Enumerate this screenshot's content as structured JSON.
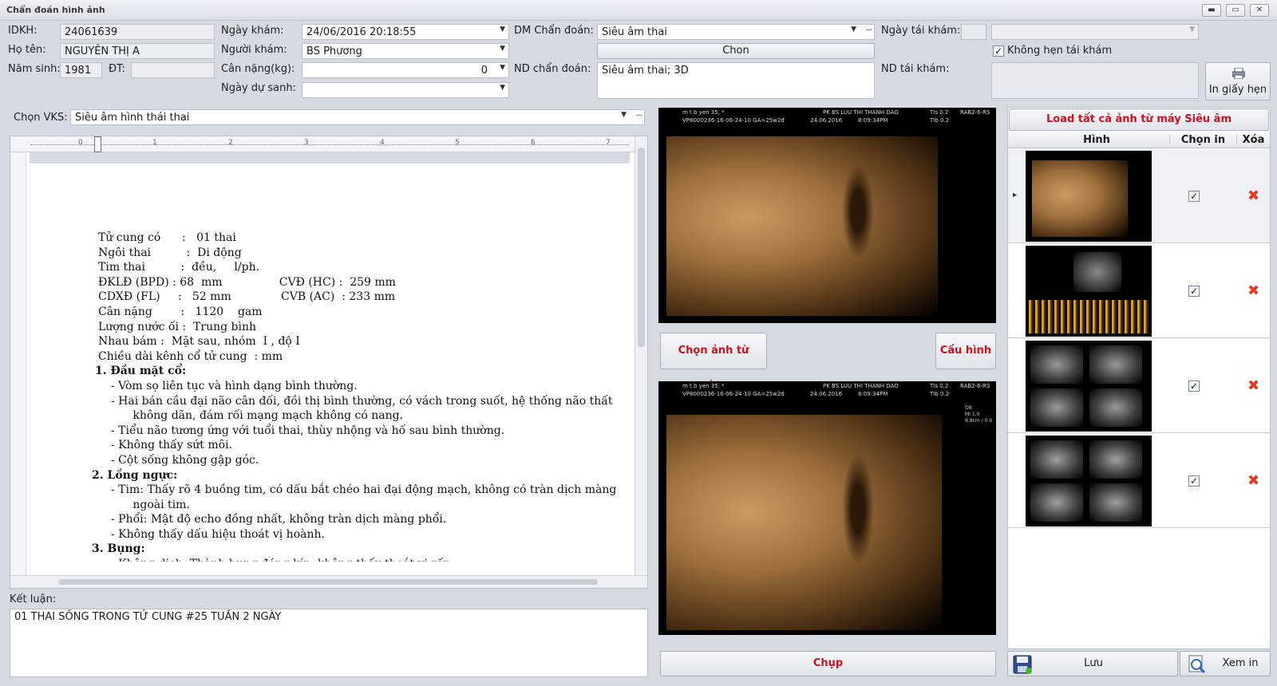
{
  "window": {
    "title": "Chẩn đoán hình ảnh",
    "min": "▬",
    "max": "▭",
    "close": "✕"
  },
  "patient": {
    "idkh_label": "IDKH:",
    "idkh": "24061639",
    "name_label": "Họ tên:",
    "name": "NGUYỄN THỊ A",
    "birth_label": "Năm sinh:",
    "birth": "1981",
    "phone_label": "ĐT:",
    "phone": ""
  },
  "exam": {
    "date_label": "Ngày khám:",
    "date": "24/06/2016 20:18:55",
    "doctor_label": "Người khám:",
    "doctor": "BS Phương",
    "weight_label": "Cân nặng(kg):",
    "weight": "0",
    "due_label": "Ngày dự sanh:",
    "due": ""
  },
  "diagnosis": {
    "dm_label": "DM Chẩn đoán:",
    "dm": "Siêu âm thai",
    "choose_button": "Chon",
    "nd_label": "ND chẩn đoán:",
    "nd": "Siêu âm thai; 3D"
  },
  "revisit": {
    "date_label": "Ngày tái khám:",
    "date": "",
    "no_appointment_label": "Không hẹn tái khám",
    "no_appointment_checked": "✓",
    "nd_label": "ND tái khám:",
    "nd": "",
    "print_button": "In giấy hẹn"
  },
  "vks": {
    "label": "Chọn VKS:",
    "value": "Siêu âm hình thái thai"
  },
  "ruler_numbers": [
    "1",
    "2",
    "3",
    "4",
    "5",
    "6",
    "7"
  ],
  "report_lines": [
    "Tử cung có      :   01 thai",
    "Ngôi thai          :  Di động",
    "Tim thai          :  đều,     l/ph.",
    "ĐKLĐ (BPD) : 68  mm                CVĐ (HC) :  259 mm",
    "CDXĐ (FL)     :   52 mm              CVB (AC)  : 233 mm",
    "Cân nặng        :   1120    gam",
    "Lượng nước ối :  Trung bình",
    "Nhau bám :  Mặt sau, nhóm  I , độ I",
    "Chiều dài kênh cổ tử cung  : mm"
  ],
  "report_sections": [
    {
      "heading": "1. Đầu mặt cổ:",
      "items": [
        "- Vòm sọ liên tục và hình dạng bình thường.",
        "- Hai bán cầu đại não cân đối, đồi thị bình thường, có vách trong suốt, hệ thống não thất",
        "   không dãn, đám rối mạng mạch không có nang.",
        "- Tiểu não tương ứng với tuổi thai, thùy nhộng và hố sau bình thường.",
        "- Không thấy sứt môi.",
        "- Cột sống không gập góc."
      ]
    },
    {
      "heading": "2. Lồng ngực:",
      "items": [
        "- Tim: Thấy rõ 4 buồng tim, có dấu bắt chéo hai đại động mạch, không có tràn dịch màng",
        "   ngoài tim.",
        "- Phổi: Mật độ echo đồng nhất, không tràn dịch màng phổi.",
        "- Không thấy dấu hiệu thoát vị hoành."
      ]
    },
    {
      "heading": "3. Bụng:",
      "items": [
        "- Không dịch. Thành bụng đóng kín, không thấy thoát vị rốn."
      ]
    }
  ],
  "conclusion": {
    "label": "Kết luận:",
    "text": "01 THAI SỐNG TRONG TỬ CUNG #25 TUẦN 2 NGÀY"
  },
  "ultrasound_header": {
    "line1": "m t b yen 35,  *",
    "clinic": "PK BS LUU THI THANH DAO",
    "line2": "VP8000236-16-06-24-10  GA=25w2d",
    "date": "24.06.2016",
    "time": "8:09:34PM",
    "right1": "RAB2-6-RS",
    "tis": "TIs 0.2",
    "tib": "TIb 0.2",
    "mi": "MI 1.0",
    "ob": "OB",
    "depth": "9.8cm / 0.9"
  },
  "middle_buttons": {
    "select_from_machine": "Chọn ảnh từ máy...",
    "config": "Cấu hình",
    "capture": "Chụp"
  },
  "image_list": {
    "load_all_button": "Load tất cả ảnh từ máy Siêu âm",
    "columns": [
      "Hình",
      "Chọn in",
      "Xóa"
    ],
    "rows": [
      {
        "selected_marker": "▸",
        "print_checked": "✓",
        "delete": "✖"
      },
      {
        "selected_marker": "",
        "print_checked": "✓",
        "delete": "✖"
      },
      {
        "selected_marker": "",
        "print_checked": "✓",
        "delete": "✖"
      },
      {
        "selected_marker": "",
        "print_checked": "✓",
        "delete": "✖"
      }
    ]
  },
  "bottom_buttons": {
    "save": "Lưu",
    "preview": "Xem in"
  }
}
